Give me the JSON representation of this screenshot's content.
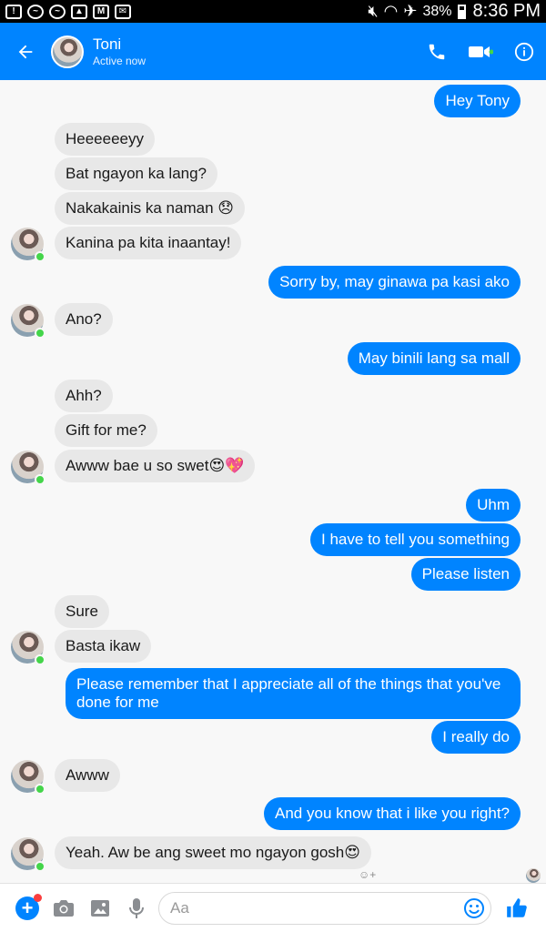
{
  "status_bar": {
    "battery": "38%",
    "time": "8:36 PM"
  },
  "header": {
    "name": "Toni",
    "status": "Active now",
    "accent": "#0084ff"
  },
  "messages": [
    {
      "text": "Hey Tony"
    },
    {
      "text": "Heeeeeeyy"
    },
    {
      "text": "Bat ngayon ka lang?"
    },
    {
      "text": "Nakakainis ka naman 😞"
    },
    {
      "text": "Kanina pa kita inaantay!"
    },
    {
      "text": "Sorry by, may ginawa pa kasi ako"
    },
    {
      "text": "Ano?"
    },
    {
      "text": "May binili lang sa mall"
    },
    {
      "text": "Ahh?"
    },
    {
      "text": "Gift for me?"
    },
    {
      "text": "Awww bae u so swet😍💖"
    },
    {
      "text": "Uhm"
    },
    {
      "text": "I have to tell you something"
    },
    {
      "text": "Please listen"
    },
    {
      "text": "Sure"
    },
    {
      "text": "Basta ikaw"
    },
    {
      "text": "Please remember that I appreciate all of the things that you've done for me"
    },
    {
      "text": "I really do"
    },
    {
      "text": "Awww"
    },
    {
      "text": "And you know that i like you right?"
    },
    {
      "text": "Yeah. Aw be ang sweet mo ngayon gosh😍"
    }
  ],
  "composer": {
    "placeholder": "Aa"
  },
  "colors": {
    "outgoing_bubble": "#0084ff",
    "incoming_bubble": "#e8e8e8",
    "online_dot": "#44d54a"
  }
}
